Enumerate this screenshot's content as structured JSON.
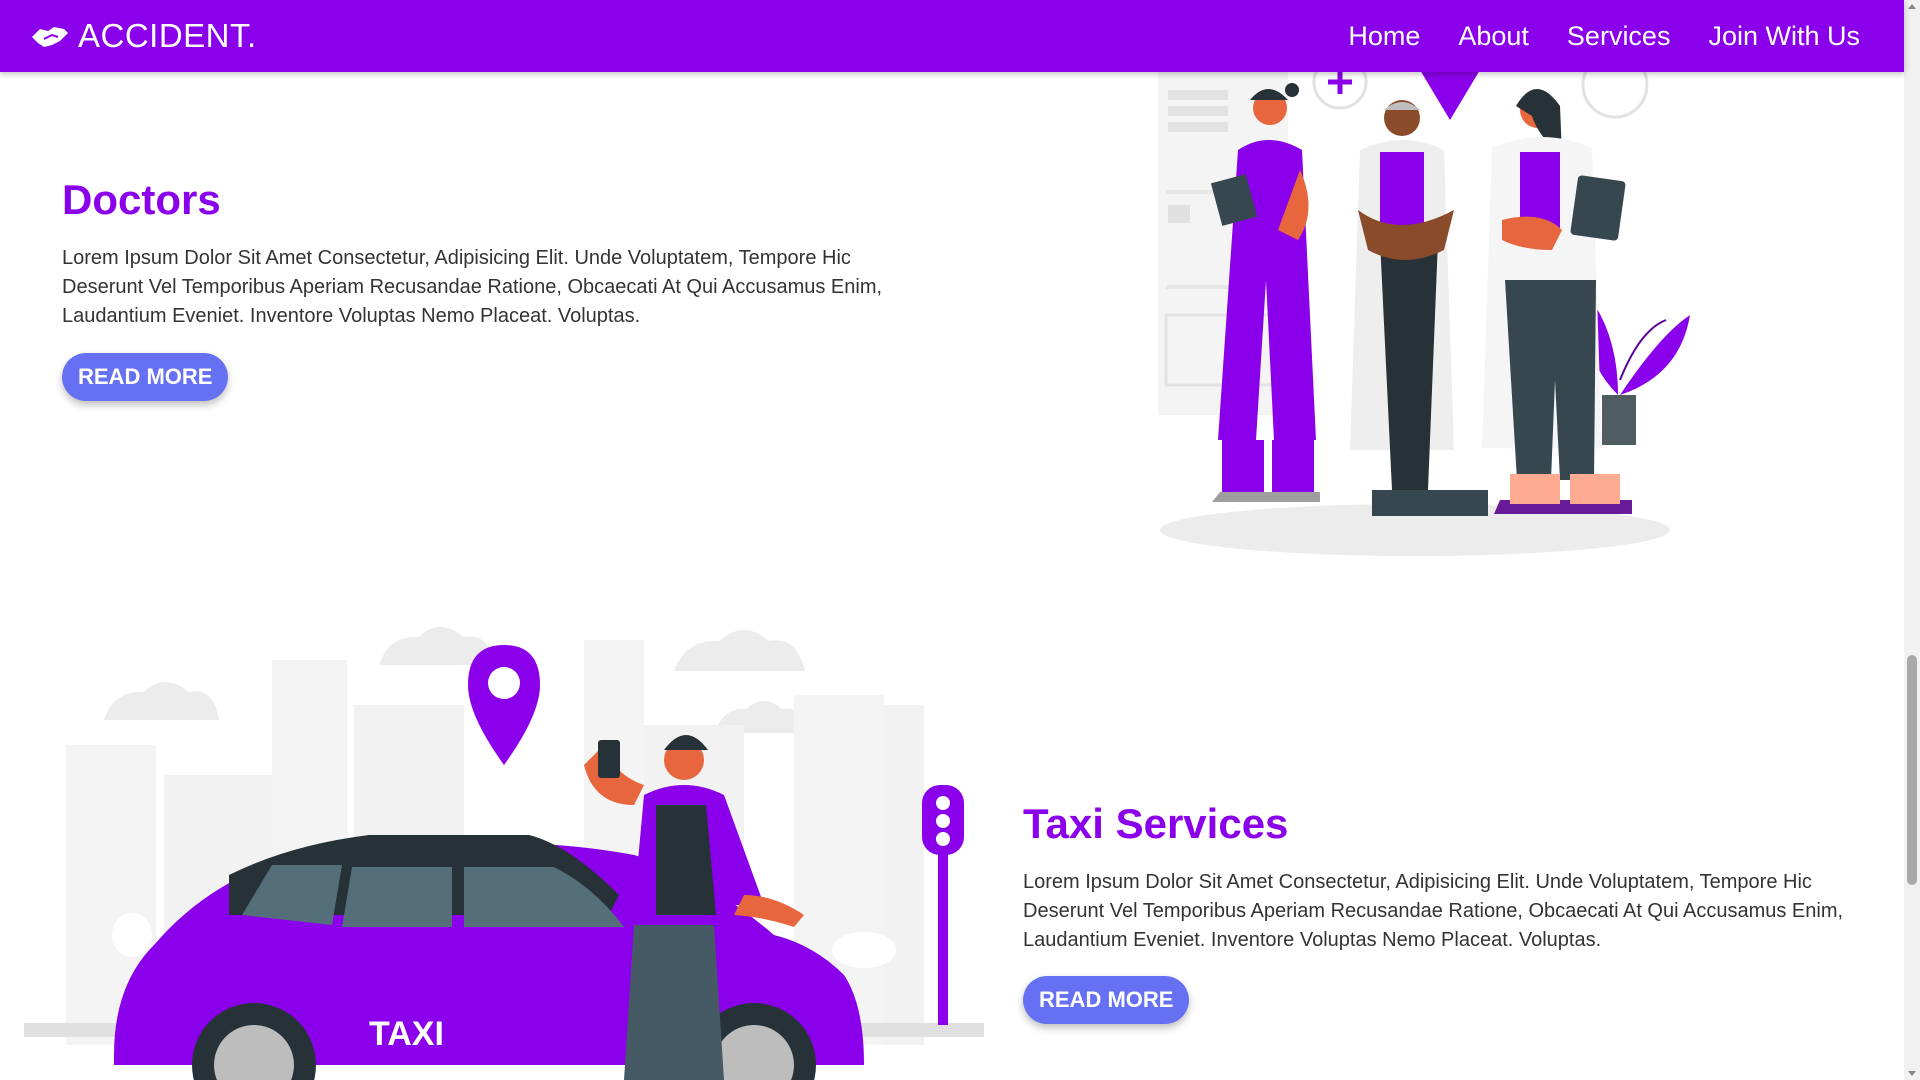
{
  "header": {
    "brand": "ACCIDENT.",
    "nav": [
      "Home",
      "About",
      "Services",
      "Join With Us"
    ]
  },
  "sections": [
    {
      "title": "Doctors",
      "text": "Lorem Ipsum Dolor Sit Amet Consectetur, Adipisicing Elit. Unde Voluptatem, Tempore Hic Deserunt Vel Temporibus Aperiam Recusandae Ratione, Obcaecati At Qui Accusamus Enim, Laudantium Eveniet. Inventore Voluptas Nemo Placeat. Voluptas.",
      "button": "READ MORE"
    },
    {
      "title": "Taxi Services",
      "text": "Lorem Ipsum Dolor Sit Amet Consectetur, Adipisicing Elit. Unde Voluptatem, Tempore Hic Deserunt Vel Temporibus Aperiam Recusandae Ratione, Obcaecati At Qui Accusamus Enim, Laudantium Eveniet. Inventore Voluptas Nemo Placeat. Voluptas.",
      "button": "READ MORE",
      "car_label": "TAXI"
    }
  ],
  "colors": {
    "primary": "#8b00ea",
    "button": "#6670f2",
    "text": "#333333"
  },
  "icons": [
    "handshake-icon",
    "map-pin-icon",
    "traffic-light-icon"
  ]
}
